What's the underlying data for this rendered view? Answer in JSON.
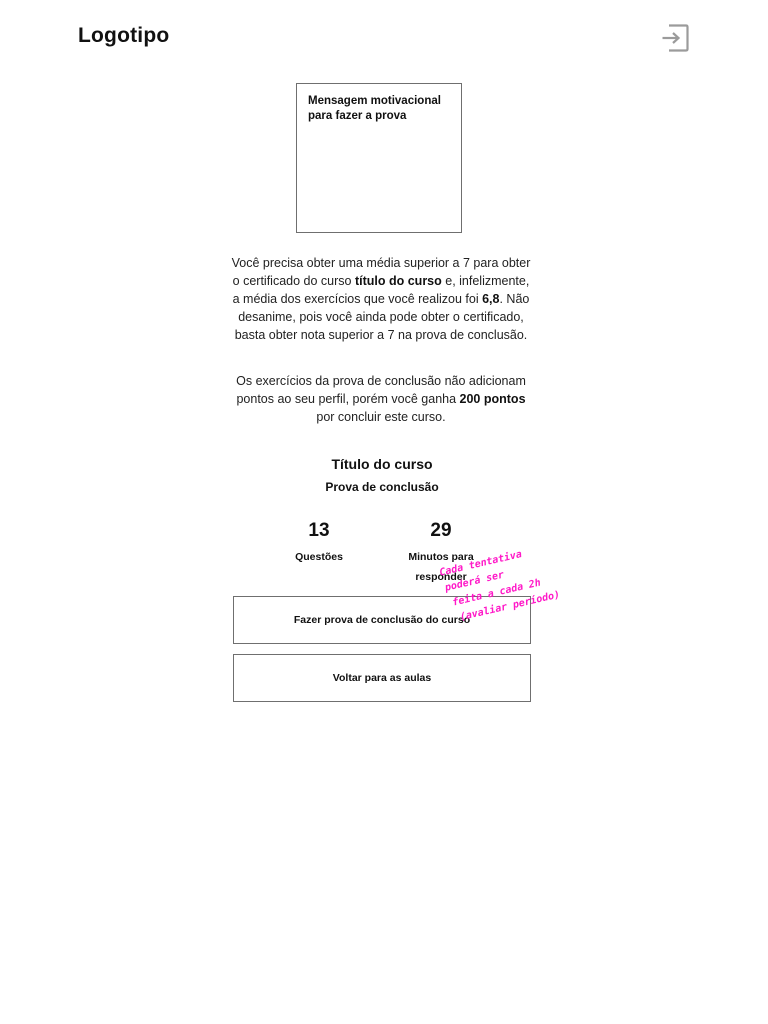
{
  "header": {
    "logo": "Logotipo",
    "exit_icon": "logout-icon"
  },
  "motivation": {
    "text": "Mensagem motivacional para fazer a prova"
  },
  "message": {
    "p1_a": "Você precisa obter uma média superior a 7 para obter o certificado do curso ",
    "p1_course": "título do curso",
    "p1_b": " e, infelizmente, a média dos exercícios que você realizou foi ",
    "p1_grade": "6,8",
    "p1_c": ". Não desanime, pois você ainda pode obter o certificado, basta obter nota superior a 7 na prova de conclusão.",
    "p2_a": "Os exercícios da prova de conclusão não adicionam pontos ao seu perfil, porém você ganha ",
    "p2_points": "200 pontos",
    "p2_b": " por concluir este curso."
  },
  "exam": {
    "course_title": "Título do curso",
    "subtitle": "Prova de conclusão",
    "questions_count": "13",
    "questions_label": "Questões",
    "minutes_count": "29",
    "minutes_label": "Minutos para responder"
  },
  "actions": {
    "start_label": "Fazer prova de conclusão do curso",
    "back_label": "Voltar para as aulas"
  },
  "annotation": {
    "line1": "Cada tentativa",
    "line2": "poderá ser",
    "line3": "feita a cada 2h",
    "line4": "(avaliar período)"
  },
  "colors": {
    "annotation": "#ff19c8",
    "border": "#6f6f6f",
    "icon": "#9b9b9b"
  }
}
